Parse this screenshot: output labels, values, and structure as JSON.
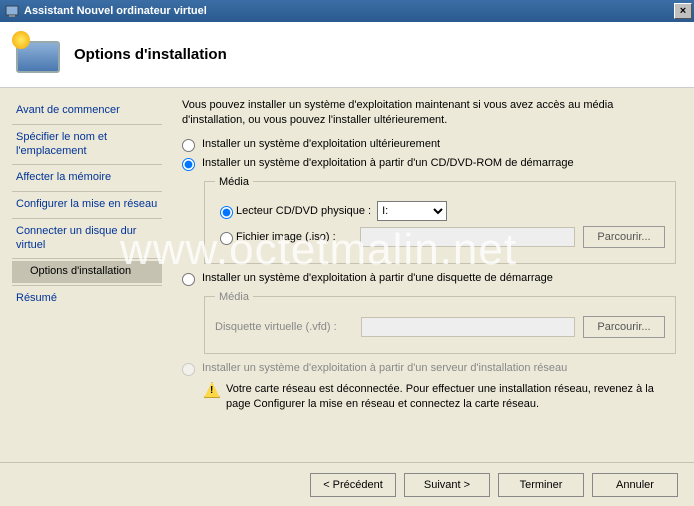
{
  "window": {
    "title": "Assistant Nouvel ordinateur virtuel"
  },
  "header": {
    "title": "Options d'installation"
  },
  "sidebar": {
    "items": [
      {
        "label": "Avant de commencer"
      },
      {
        "label": "Spécifier le nom et l'emplacement"
      },
      {
        "label": "Affecter la mémoire"
      },
      {
        "label": "Configurer la mise en réseau"
      },
      {
        "label": "Connecter un disque dur virtuel"
      },
      {
        "label": "Options d'installation"
      },
      {
        "label": "Résumé"
      }
    ],
    "current_index": 5
  },
  "main": {
    "intro": "Vous pouvez installer un système d'exploitation maintenant si vous avez accès au média d'installation, ou vous pouvez l'installer ultérieurement.",
    "opt_later": "Installer un système d'exploitation ultérieurement",
    "opt_cd": "Installer un système d'exploitation à partir d'un CD/DVD-ROM de démarrage",
    "media_legend": "Média",
    "opt_physical": "Lecteur CD/DVD physique :",
    "drive_value": "I:",
    "opt_iso": "Fichier image (.iso) :",
    "browse": "Parcourir...",
    "opt_floppy": "Installer un système d'exploitation à partir d'une disquette de démarrage",
    "floppy_legend": "Média",
    "floppy_label": "Disquette virtuelle (.vfd) :",
    "opt_network": "Installer un système d'exploitation à partir d'un serveur d'installation réseau",
    "net_warning": "Votre carte réseau est déconnectée. Pour effectuer une installation réseau, revenez à la page Configurer la mise en réseau et connectez la carte réseau."
  },
  "footer": {
    "prev": "< Précédent",
    "next": "Suivant >",
    "finish": "Terminer",
    "cancel": "Annuler"
  },
  "watermark": "www.octetmalin.net"
}
